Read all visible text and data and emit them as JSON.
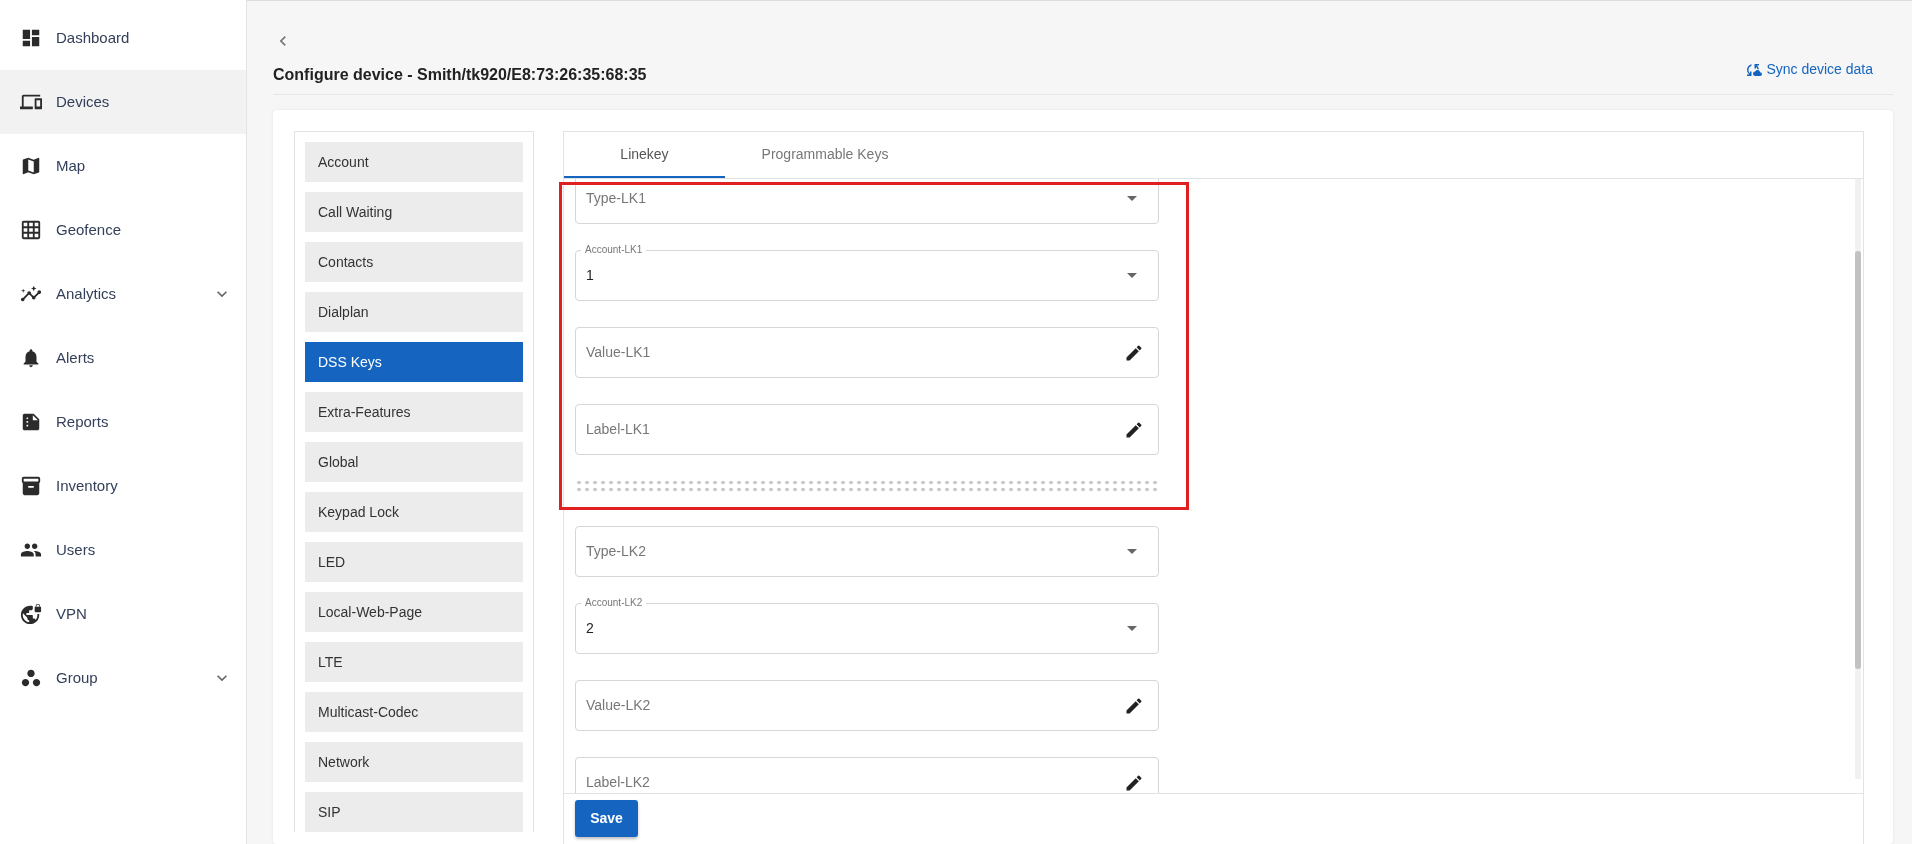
{
  "sidebar": {
    "items": [
      {
        "label": "Dashboard",
        "selected": false,
        "expandable": false
      },
      {
        "label": "Devices",
        "selected": true,
        "expandable": false
      },
      {
        "label": "Map",
        "selected": false,
        "expandable": false
      },
      {
        "label": "Geofence",
        "selected": false,
        "expandable": false
      },
      {
        "label": "Analytics",
        "selected": false,
        "expandable": true
      },
      {
        "label": "Alerts",
        "selected": false,
        "expandable": false
      },
      {
        "label": "Reports",
        "selected": false,
        "expandable": false
      },
      {
        "label": "Inventory",
        "selected": false,
        "expandable": false
      },
      {
        "label": "Users",
        "selected": false,
        "expandable": false
      },
      {
        "label": "VPN",
        "selected": false,
        "expandable": false
      },
      {
        "label": "Group",
        "selected": false,
        "expandable": true
      }
    ]
  },
  "page": {
    "title": "Configure device - Smith/tk920/E8:73:26:35:68:35",
    "sync_label": "Sync device data"
  },
  "settings_menu": [
    {
      "label": "Account",
      "selected": false
    },
    {
      "label": "Call Waiting",
      "selected": false
    },
    {
      "label": "Contacts",
      "selected": false
    },
    {
      "label": "Dialplan",
      "selected": false
    },
    {
      "label": "DSS Keys",
      "selected": true
    },
    {
      "label": "Extra-Features",
      "selected": false
    },
    {
      "label": "Global",
      "selected": false
    },
    {
      "label": "Keypad Lock",
      "selected": false
    },
    {
      "label": "LED",
      "selected": false
    },
    {
      "label": "Local-Web-Page",
      "selected": false
    },
    {
      "label": "LTE",
      "selected": false
    },
    {
      "label": "Multicast-Codec",
      "selected": false
    },
    {
      "label": "Network",
      "selected": false
    },
    {
      "label": "SIP",
      "selected": false
    }
  ],
  "tabs": [
    {
      "label": "Linekey",
      "selected": true
    },
    {
      "label": "Programmable Keys",
      "selected": false
    }
  ],
  "key_groups": [
    {
      "highlighted": true,
      "fields": [
        {
          "kind": "select",
          "label": "Type-LK1"
        },
        {
          "kind": "select",
          "label": "Account-LK1",
          "value": "1"
        },
        {
          "kind": "text",
          "label": "Value-LK1"
        },
        {
          "kind": "text",
          "label": "Label-LK1"
        }
      ]
    },
    {
      "highlighted": false,
      "fields": [
        {
          "kind": "select",
          "label": "Type-LK2"
        },
        {
          "kind": "select",
          "label": "Account-LK2",
          "value": "2"
        },
        {
          "kind": "text",
          "label": "Value-LK2"
        },
        {
          "kind": "text",
          "label": "Label-LK2"
        }
      ]
    }
  ],
  "save_button": "Save"
}
